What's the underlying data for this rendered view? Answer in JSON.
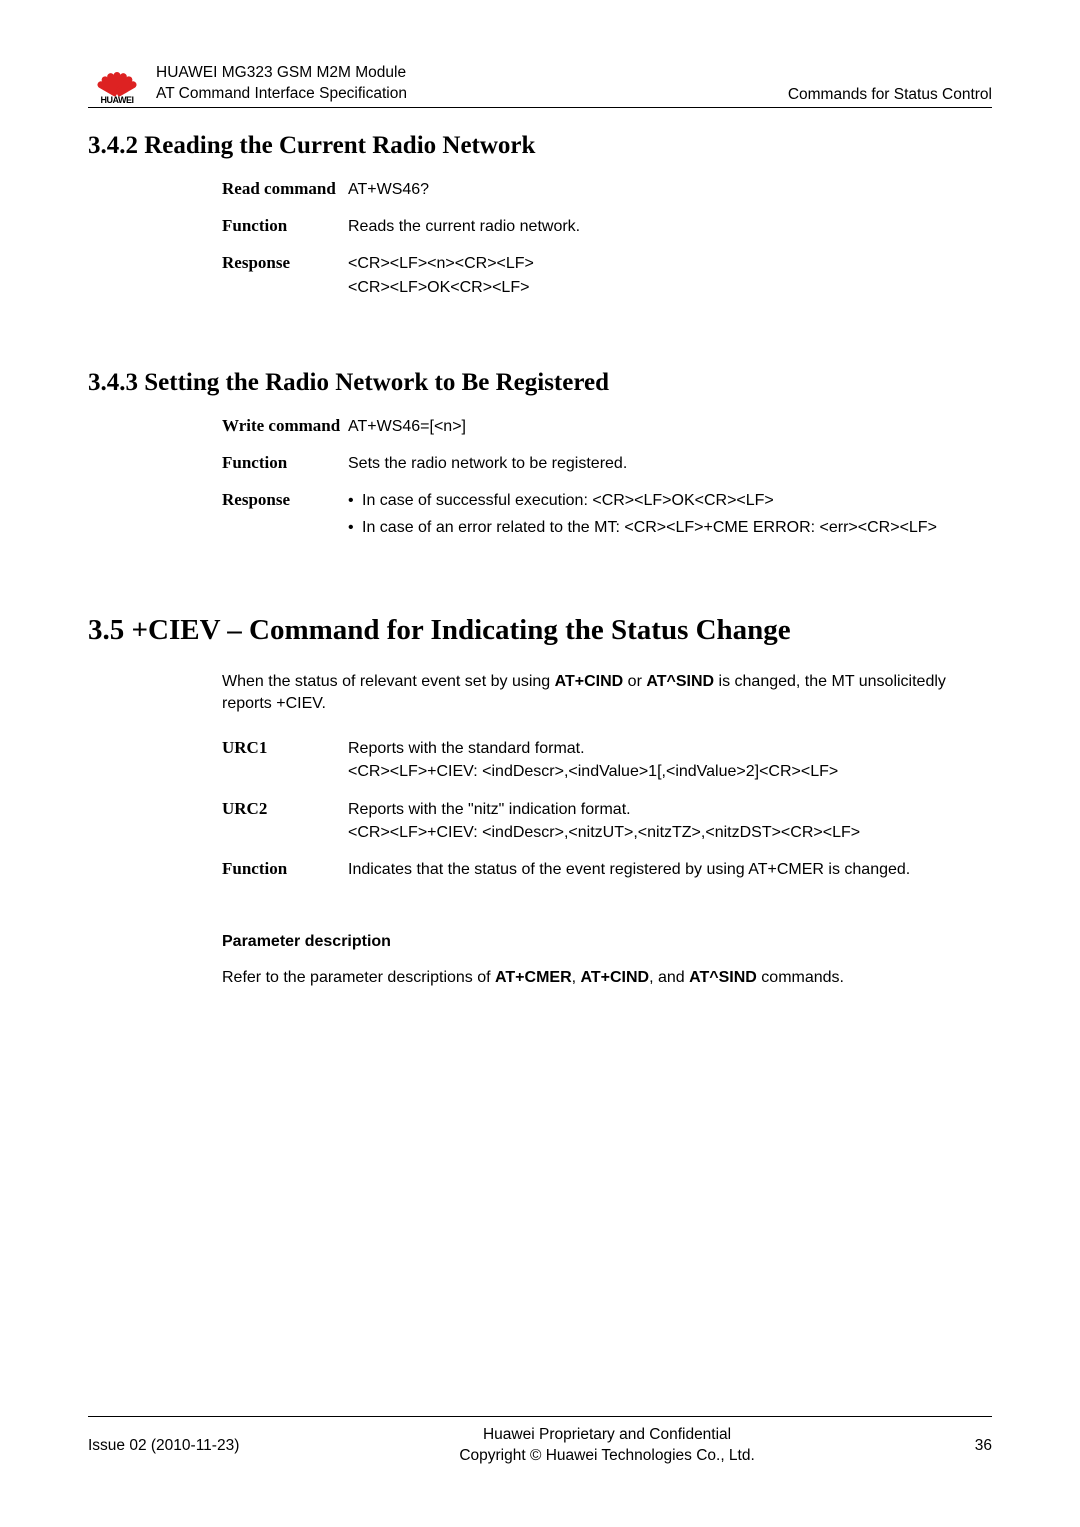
{
  "header": {
    "logo_text": "HUAWEI",
    "line1": "HUAWEI MG323 GSM M2M Module",
    "line2": "AT Command Interface Specification",
    "right": "Commands for Status Control"
  },
  "section_342": {
    "heading": "3.4.2 Reading the Current Radio Network",
    "rows": {
      "read_label": "Read command",
      "read_val": "AT+WS46?",
      "func_label": "Function",
      "func_val": "Reads the current radio network.",
      "resp_label": "Response",
      "resp_line1": "<CR><LF><n><CR><LF>",
      "resp_line2": "<CR><LF>OK<CR><LF>"
    }
  },
  "section_343": {
    "heading": "3.4.3 Setting the Radio Network to Be Registered",
    "rows": {
      "write_label": "Write command",
      "write_val": "AT+WS46=[<n>]",
      "func_label": "Function",
      "func_val": "Sets the radio network to be registered.",
      "resp_label": "Response",
      "resp_bullet1": "In case of successful execution: <CR><LF>OK<CR><LF>",
      "resp_bullet2": "In case of an error related to the MT: <CR><LF>+CME ERROR: <err><CR><LF>"
    }
  },
  "section_35": {
    "heading": "3.5 +CIEV – Command for Indicating the Status Change",
    "intro_pre": "When the status of relevant event set by using ",
    "intro_b1": "AT+CIND",
    "intro_mid": " or ",
    "intro_b2": "AT^SIND",
    "intro_post": " is changed, the MT unsolicitedly reports +CIEV.",
    "rows": {
      "urc1_label": "URC1",
      "urc1_line1": "Reports with the standard format.",
      "urc1_line2": "<CR><LF>+CIEV: <indDescr>,<indValue>1[,<indValue>2]<CR><LF>",
      "urc2_label": "URC2",
      "urc2_line1": "Reports with the \"nitz\" indication format.",
      "urc2_line2": "<CR><LF>+CIEV: <indDescr>,<nitzUT>,<nitzTZ>,<nitzDST><CR><LF>",
      "func_label": "Function",
      "func_val": "Indicates that the status of the event registered by using AT+CMER is changed."
    },
    "param_heading": "Parameter description",
    "param_pre": "Refer to the parameter descriptions of ",
    "param_b1": "AT+CMER",
    "param_sep1": ", ",
    "param_b2": "AT+CIND",
    "param_sep2": ", and ",
    "param_b3": "AT^SIND",
    "param_post": " commands."
  },
  "footer": {
    "left": "Issue 02 (2010-11-23)",
    "center1": "Huawei Proprietary and Confidential",
    "center2": "Copyright © Huawei Technologies Co., Ltd.",
    "right": "36"
  }
}
